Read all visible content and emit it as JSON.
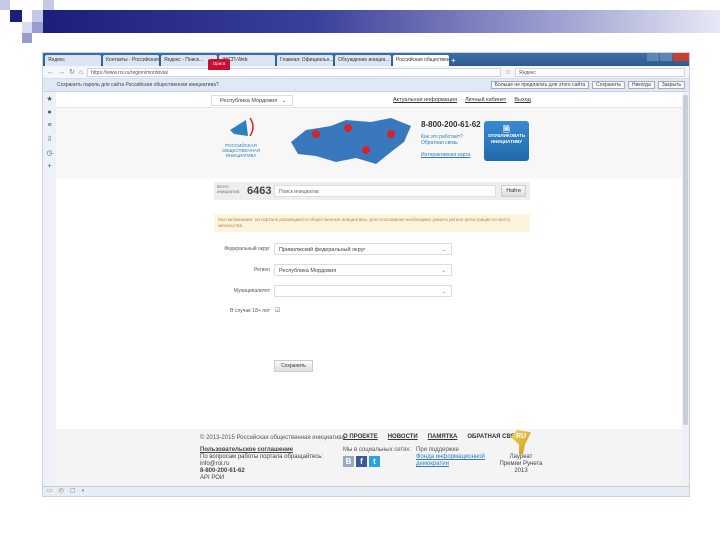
{
  "browser": {
    "tabs": [
      "Opera",
      "Яндекс",
      "Контакты - Российская...",
      "Яндекс - Поиск...",
      "ЭКСП-Web",
      "Главная: Официальн...",
      "Обсуждение инициа...",
      "Российская общественн..."
    ],
    "active_tab": 7,
    "url": "https://www.roi.ru/region/mordovia/",
    "search_placeholder": "Яндекс",
    "infobar_text": "Сохранить пароль для сайта Российская общественная инициатива?",
    "infobar_check": "Больше не предлагать для этого сайта",
    "infobar_buttons": [
      "Сохранить",
      "Никогда",
      "Закрыть"
    ]
  },
  "header": {
    "region": "Республика Мордовия",
    "links": [
      "Актуальная информация",
      "Личный кабинет",
      "Выход"
    ],
    "logo_text": "РОССИЙСКАЯ ОБЩЕСТВЕННАЯ ИНИЦИАТИВА",
    "phone": "8-800-200-61-62",
    "how_it_works": "Как это работает?",
    "feedback": "Обратная связь",
    "interactive_map": "Интерактивная карта",
    "publish_button": "ОПУБЛИКОВАТЬ ИНИЦИАТИВУ"
  },
  "search": {
    "count_label": "Всего инициатив:",
    "count": "6463",
    "placeholder": "Поиск инициатив",
    "button": "Найти"
  },
  "notice": "Мы напоминаем: на портале размещаются общественные инициативы, для голосования необходимо указать регион регистрации по месту жительства.",
  "form": {
    "fields": [
      {
        "label": "Федеральный округ",
        "value": "Приволжский федеральный округ"
      },
      {
        "label": "Регион",
        "value": "Республика Мордовия"
      },
      {
        "label": "Муниципалитет",
        "value": ""
      }
    ],
    "checkbox_label": "В случае 18+ лет",
    "save_button": "Сохранить"
  },
  "footer": {
    "copyright": "© 2013-2015 Российская общественная инициатива",
    "menu": [
      "О ПРОЕКТЕ",
      "НОВОСТИ",
      "ПАМЯТКА",
      "ОБРАТНАЯ СВЯЗЬ"
    ],
    "agreement": "Пользовательское соглашение",
    "contact_text": "По вопросам работы портала обращайтесь:",
    "email": "info@roi.ru",
    "phone": "8-800-200-61-62",
    "api": "API РОИ",
    "social_label": "Мы в социальных сетях:",
    "social": [
      "В",
      "f",
      "t"
    ],
    "support_label": "При поддержке",
    "support_link": "Фонда информационной демократии",
    "award": "Лауреат Премии Рунета 2013",
    "award_badge": "RU"
  }
}
